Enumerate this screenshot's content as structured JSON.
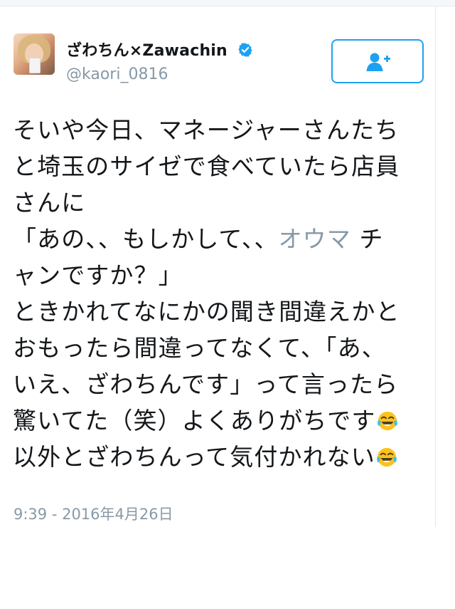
{
  "tweet": {
    "display_name": "ざわちん×Zawachin",
    "handle": "@kaori_0816",
    "verified_icon": "verified-badge-icon",
    "follow_icon": "follow-user-plus-icon",
    "accent_color": "#1da1f2",
    "text_lines": [
      "そいや今日、マネージャーさんたち",
      "と埼玉のサイゼで食べていたら店員",
      "さんに",
      "「あの、、もしかして、、",
      "オウマ",
      "チ",
      "ャンですか？」",
      "ときかれてなにかの聞き間違えかと",
      "おもったら間違ってなくて、「あ、",
      "いえ、ざわちんです」って言ったら",
      "驚いてた（笑）よくありがちです",
      "以外とざわちんって気付かれない"
    ],
    "emoji": "face-with-tears-of-joy-emoji",
    "timestamp": "9:39 - 2016年4月26日"
  }
}
